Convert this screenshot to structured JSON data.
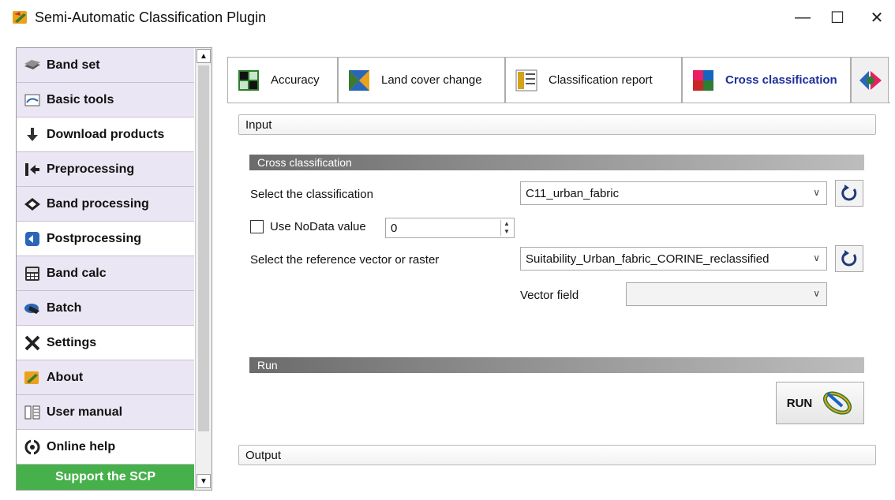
{
  "window": {
    "title": "Semi-Automatic Classification Plugin",
    "controls": {
      "minimize": "—",
      "maximize": "☐",
      "close": "✕"
    }
  },
  "sidebar": {
    "items": [
      {
        "label": "Band set",
        "icon": "band-set-icon"
      },
      {
        "label": "Basic tools",
        "icon": "basic-tools-icon"
      },
      {
        "label": "Download products",
        "icon": "download-icon"
      },
      {
        "label": "Preprocessing",
        "icon": "preprocessing-icon"
      },
      {
        "label": "Band processing",
        "icon": "band-processing-icon"
      },
      {
        "label": "Postprocessing",
        "icon": "postprocessing-icon"
      },
      {
        "label": "Band calc",
        "icon": "band-calc-icon"
      },
      {
        "label": "Batch",
        "icon": "batch-icon"
      },
      {
        "label": "Settings",
        "icon": "settings-icon"
      },
      {
        "label": "About",
        "icon": "about-icon"
      },
      {
        "label": "User manual",
        "icon": "user-manual-icon"
      },
      {
        "label": "Online help",
        "icon": "online-help-icon"
      }
    ],
    "support_label": "Support the SCP"
  },
  "tabs": [
    {
      "label": "Accuracy",
      "active": false
    },
    {
      "label": "Land cover change",
      "active": false
    },
    {
      "label": "Classification report",
      "active": false
    },
    {
      "label": "Cross classification",
      "active": true
    }
  ],
  "input_group": "Input",
  "output_group": "Output",
  "section_cross": "Cross classification",
  "section_run": "Run",
  "form": {
    "classification_label": "Select the classification",
    "classification_value": "C11_urban_fabric",
    "nodata_label": "Use NoData value",
    "nodata_checked": false,
    "nodata_value": "0",
    "reference_label": "Select the reference vector or raster",
    "reference_value": "Suitability_Urban_fabric_CORINE_reclassified",
    "vector_field_label": "Vector field",
    "vector_field_value": ""
  },
  "run_label": "RUN",
  "colors": {
    "sidebar_bg": "#ebe6f3",
    "support_green": "#46b04a",
    "active_tab_text": "#1d2f9c"
  }
}
